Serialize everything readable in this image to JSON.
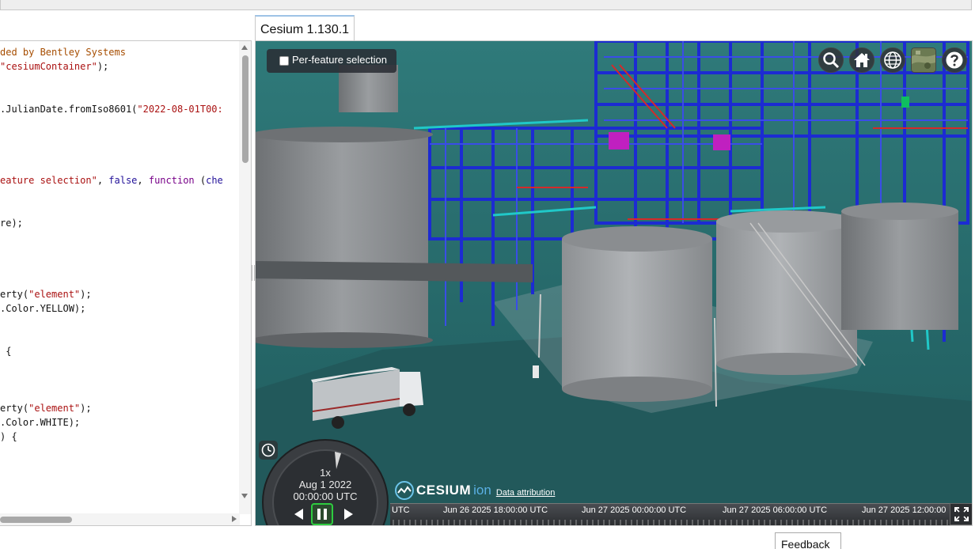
{
  "tab": {
    "label": "Cesium 1.130.1"
  },
  "code_editor": {
    "lines": [
      [
        {
          "t": "c",
          "v": "ded by Bentley Systems"
        }
      ],
      [
        {
          "t": "s",
          "v": "\"cesiumContainer\""
        },
        {
          "t": "p",
          "v": ");"
        }
      ],
      [
        {
          "t": "p",
          "v": ""
        }
      ],
      [
        {
          "t": "p",
          "v": ""
        }
      ],
      [
        {
          "t": "p",
          "v": ".JulianDate.fromIso8601("
        },
        {
          "t": "s",
          "v": "\"2022-08-01T00:"
        }
      ],
      [
        {
          "t": "p",
          "v": ""
        }
      ],
      [
        {
          "t": "p",
          "v": ""
        }
      ],
      [
        {
          "t": "p",
          "v": ""
        }
      ],
      [
        {
          "t": "p",
          "v": ""
        }
      ],
      [
        {
          "t": "s",
          "v": "eature selection\""
        },
        {
          "t": "p",
          "v": ", "
        },
        {
          "t": "b",
          "v": "false"
        },
        {
          "t": "p",
          "v": ", "
        },
        {
          "t": "k",
          "v": "function"
        },
        {
          "t": "p",
          "v": " ("
        },
        {
          "t": "b",
          "v": "che"
        }
      ],
      [
        {
          "t": "p",
          "v": ""
        }
      ],
      [
        {
          "t": "p",
          "v": ""
        }
      ],
      [
        {
          "t": "p",
          "v": "re);"
        }
      ],
      [
        {
          "t": "p",
          "v": ""
        }
      ],
      [
        {
          "t": "p",
          "v": ""
        }
      ],
      [
        {
          "t": "p",
          "v": ""
        }
      ],
      [
        {
          "t": "p",
          "v": ""
        }
      ],
      [
        {
          "t": "p",
          "v": "erty("
        },
        {
          "t": "s",
          "v": "\"element\""
        },
        {
          "t": "p",
          "v": ");"
        }
      ],
      [
        {
          "t": "p",
          "v": ".Color.YELLOW);"
        }
      ],
      [
        {
          "t": "p",
          "v": ""
        }
      ],
      [
        {
          "t": "p",
          "v": ""
        }
      ],
      [
        {
          "t": "p",
          "v": " {"
        }
      ],
      [
        {
          "t": "p",
          "v": ""
        }
      ],
      [
        {
          "t": "p",
          "v": ""
        }
      ],
      [
        {
          "t": "p",
          "v": ""
        }
      ],
      [
        {
          "t": "p",
          "v": "erty("
        },
        {
          "t": "s",
          "v": "\"element\""
        },
        {
          "t": "p",
          "v": ");"
        }
      ],
      [
        {
          "t": "p",
          "v": ".Color.WHITE);"
        }
      ],
      [
        {
          "t": "p",
          "v": ") {"
        }
      ]
    ]
  },
  "viewer": {
    "feature_toggle_label": "Per-feature selection",
    "toolbar": [
      "search-icon",
      "home-icon",
      "globe-icon",
      "imagery-layer-icon",
      "help-icon"
    ],
    "animation": {
      "speed": "1x",
      "date": "Aug 1 2022",
      "time": "00:00:00 UTC"
    },
    "credit": {
      "brand": "CESIUM",
      "product": "ion",
      "attribution_link": "Data attribution"
    },
    "timeline": {
      "labels": [
        "UTC",
        "Jun 26 2025 18:00:00 UTC",
        "Jun 27 2025 00:00:00 UTC",
        "Jun 27 2025 06:00:00 UTC",
        "Jun 27 2025 12:00:00"
      ]
    }
  },
  "feedback_label": "Feedback",
  "colors": {
    "steel_blue": "#1f2fd8",
    "tank_gray": "#8a8d90",
    "ground_teal": "#2a6e6e",
    "accent_magenta": "#c020c0",
    "timeline_bg": "#2c2e31"
  }
}
